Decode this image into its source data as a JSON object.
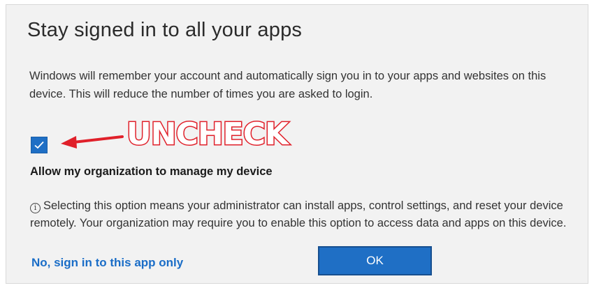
{
  "dialog": {
    "title": "Stay signed in to all your apps",
    "description": "Windows will remember your account and automatically sign you in to your apps and websites on this device. This will reduce the number of times you are asked to login.",
    "checkbox": {
      "checked": true,
      "label": "Allow my organization to manage my device"
    },
    "info_text": "Selecting this option means your administrator can install apps, control settings, and reset your device remotely. Your organization may require you to enable this option to access data and apps on this device.",
    "secondary_link": "No, sign in to this app only",
    "ok_button": "OK"
  },
  "annotation": {
    "text": "UNCHECK",
    "color": "#e0202a"
  },
  "colors": {
    "accent": "#1f6fc5",
    "link": "#1a6dc7",
    "background": "#f2f2f2"
  },
  "icons": {
    "info": "info-icon",
    "check": "checkmark-icon",
    "arrow": "arrow-left-icon"
  }
}
